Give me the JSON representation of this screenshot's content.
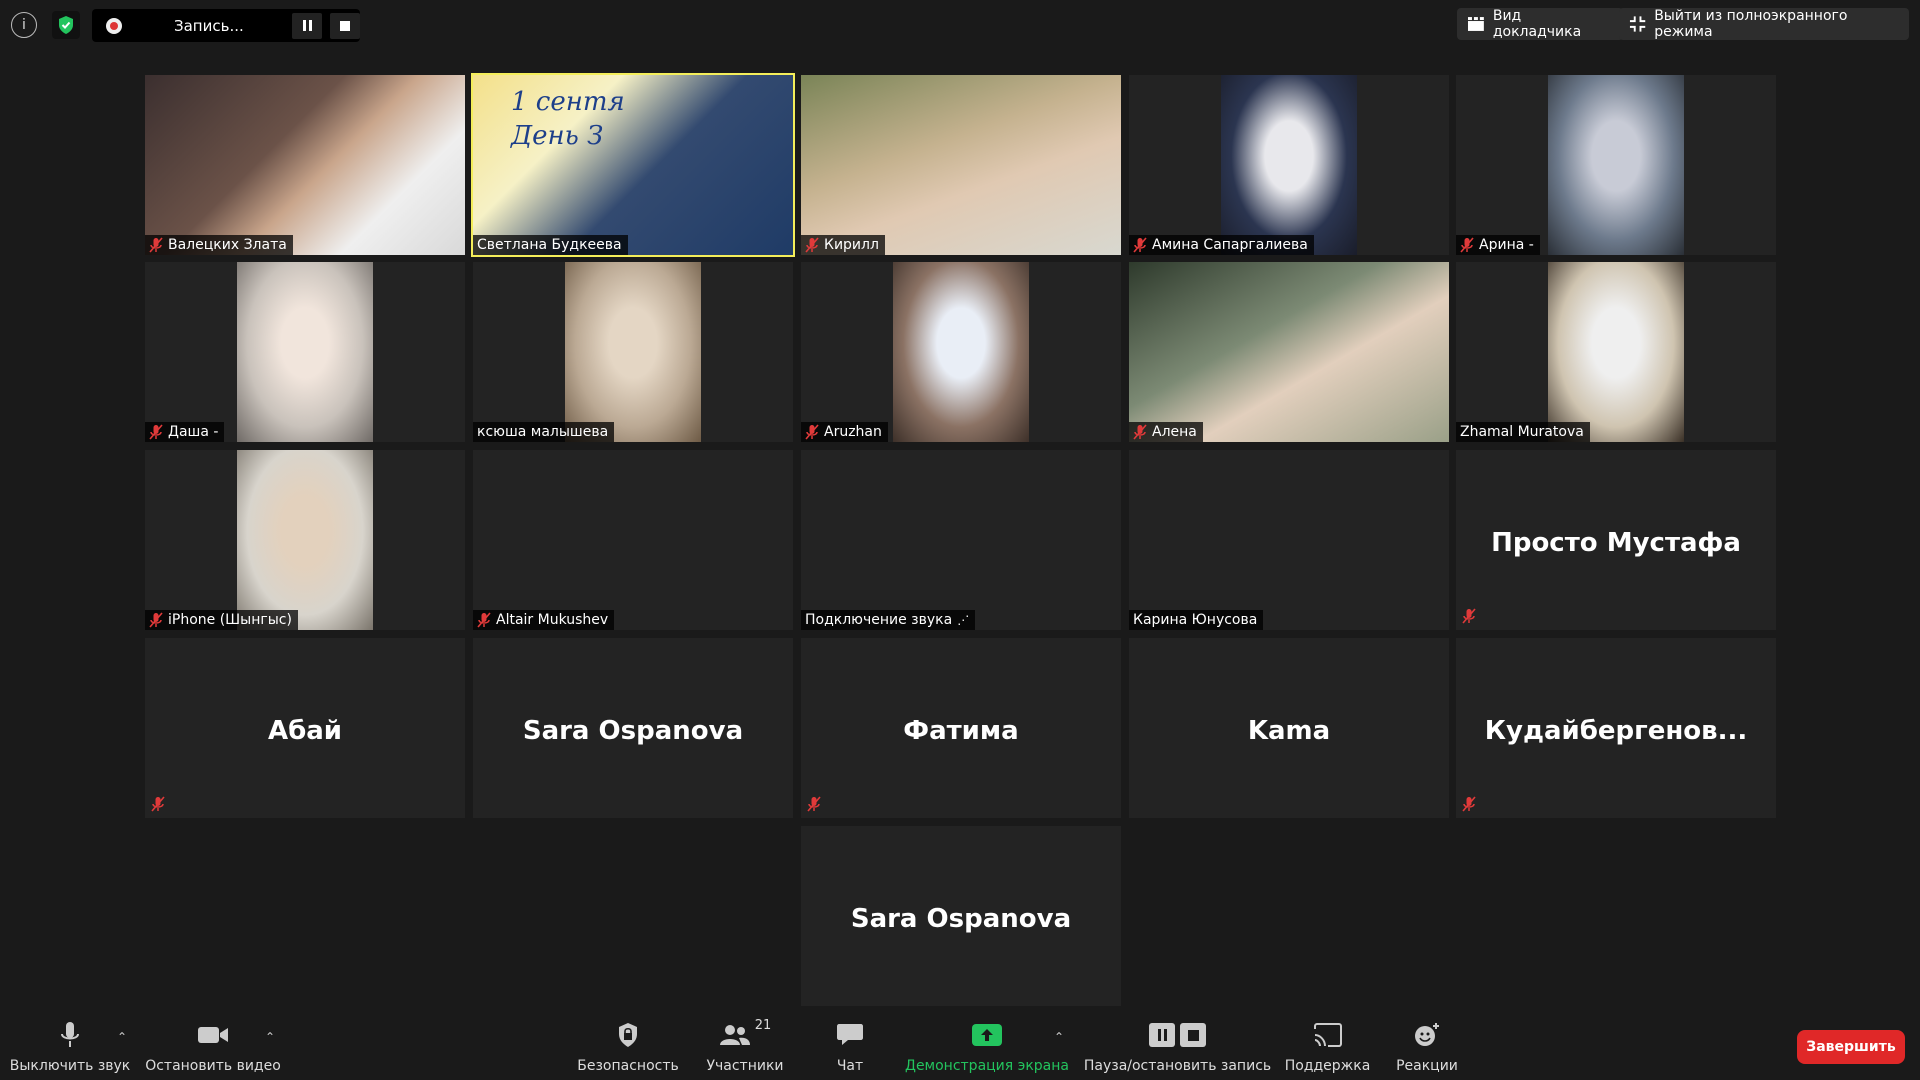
{
  "topbar": {
    "recording_label": "Запись...",
    "speaker_view": "Вид докладчика",
    "exit_fullscreen": "Выйти из полноэкранного режима"
  },
  "participants": [
    {
      "name": "Валецких Злата",
      "muted": true,
      "video": true
    },
    {
      "name": "Светлана Будкеева",
      "muted": false,
      "video": true,
      "active": true,
      "overlay": "1 сентя\nДень З"
    },
    {
      "name": "Кирилл",
      "muted": true,
      "video": true
    },
    {
      "name": "Амина Сапаргалиева",
      "muted": true,
      "video": true
    },
    {
      "name": "Арина -",
      "muted": true,
      "video": true
    },
    {
      "name": "Даша -",
      "muted": true,
      "video": true
    },
    {
      "name": "ксюша малышева",
      "muted": false,
      "video": true
    },
    {
      "name": "Aruzhan",
      "muted": true,
      "video": true
    },
    {
      "name": "Алена",
      "muted": true,
      "video": true
    },
    {
      "name": "Zhamal Muratova",
      "muted": false,
      "video": true
    },
    {
      "name": "iPhone (Шынгыс)",
      "muted": true,
      "video": true
    },
    {
      "name": "Altair Mukushev",
      "muted": true,
      "video": false
    },
    {
      "name": "Подключение звука",
      "muted": false,
      "video": false
    },
    {
      "name": "Карина Юнусова",
      "muted": false,
      "video": false
    },
    {
      "name": "Просто Мустафа",
      "muted": true,
      "video": false,
      "big": true
    },
    {
      "name": "Абай",
      "muted": true,
      "video": false,
      "big": true
    },
    {
      "name": "Sara Ospanova",
      "muted": false,
      "video": false,
      "big": true
    },
    {
      "name": "Фатима",
      "muted": true,
      "video": false,
      "big": true
    },
    {
      "name": "Kama",
      "muted": false,
      "video": false,
      "big": true
    },
    {
      "name": "Кудайбергенов...",
      "muted": true,
      "video": false,
      "big": true
    },
    {
      "name": "Sara Ospanova",
      "muted": false,
      "video": false,
      "big": true
    }
  ],
  "bottombar": {
    "mute": "Выключить звук",
    "stop_video": "Остановить видео",
    "security": "Безопасность",
    "participants": "Участники",
    "participants_count": "21",
    "chat": "Чат",
    "share_screen": "Демонстрация экрана",
    "pause_stop_record": "Пауза/остановить запись",
    "support": "Поддержка",
    "reactions": "Реакции",
    "end": "Завершить"
  },
  "colors": {
    "active_speaker": "#f4ee5a",
    "share_green": "#23c45e",
    "end_red": "#e02828"
  }
}
